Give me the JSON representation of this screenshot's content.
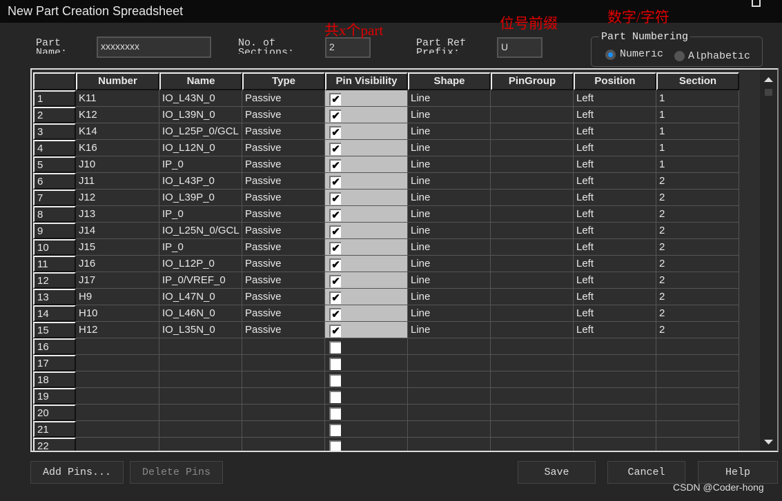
{
  "window": {
    "title": "New Part Creation Spreadsheet"
  },
  "form": {
    "part_name_label": "Part\nName:",
    "part_name_value": "xxxxxxxx",
    "sections_label": "No. of\nSections:",
    "sections_value": "2",
    "ref_prefix_label": "Part Ref\nPrefix:",
    "ref_prefix_value": "U",
    "numbering": {
      "title": "Part Numbering",
      "numeric": "Numeric",
      "alphabetic": "Alphabetic",
      "selected": "Numeric"
    }
  },
  "annotations": {
    "sections": "共x个part",
    "prefix": "位号前缀",
    "numbering": "数字/字符"
  },
  "table": {
    "columns": [
      "Number",
      "Name",
      "Type",
      "Pin Visibility",
      "Shape",
      "PinGroup",
      "Position",
      "Section"
    ],
    "rows": [
      {
        "n": "1",
        "number": "K11",
        "name": "IO_L43N_0",
        "type": "Passive",
        "visible": true,
        "shape": "Line",
        "group": "",
        "position": "Left",
        "section": "1"
      },
      {
        "n": "2",
        "number": "K12",
        "name": "IO_L39N_0",
        "type": "Passive",
        "visible": true,
        "shape": "Line",
        "group": "",
        "position": "Left",
        "section": "1"
      },
      {
        "n": "3",
        "number": "K14",
        "name": "IO_L25P_0/GCL",
        "type": "Passive",
        "visible": true,
        "shape": "Line",
        "group": "",
        "position": "Left",
        "section": "1"
      },
      {
        "n": "4",
        "number": "K16",
        "name": "IO_L12N_0",
        "type": "Passive",
        "visible": true,
        "shape": "Line",
        "group": "",
        "position": "Left",
        "section": "1"
      },
      {
        "n": "5",
        "number": "J10",
        "name": "IP_0",
        "type": "Passive",
        "visible": true,
        "shape": "Line",
        "group": "",
        "position": "Left",
        "section": "1"
      },
      {
        "n": "6",
        "number": "J11",
        "name": "IO_L43P_0",
        "type": "Passive",
        "visible": true,
        "shape": "Line",
        "group": "",
        "position": "Left",
        "section": "2"
      },
      {
        "n": "7",
        "number": "J12",
        "name": "IO_L39P_0",
        "type": "Passive",
        "visible": true,
        "shape": "Line",
        "group": "",
        "position": "Left",
        "section": "2"
      },
      {
        "n": "8",
        "number": "J13",
        "name": "IP_0",
        "type": "Passive",
        "visible": true,
        "shape": "Line",
        "group": "",
        "position": "Left",
        "section": "2"
      },
      {
        "n": "9",
        "number": "J14",
        "name": "IO_L25N_0/GCL",
        "type": "Passive",
        "visible": true,
        "shape": "Line",
        "group": "",
        "position": "Left",
        "section": "2"
      },
      {
        "n": "10",
        "number": "J15",
        "name": "IP_0",
        "type": "Passive",
        "visible": true,
        "shape": "Line",
        "group": "",
        "position": "Left",
        "section": "2"
      },
      {
        "n": "11",
        "number": "J16",
        "name": "IO_L12P_0",
        "type": "Passive",
        "visible": true,
        "shape": "Line",
        "group": "",
        "position": "Left",
        "section": "2"
      },
      {
        "n": "12",
        "number": "J17",
        "name": "IP_0/VREF_0",
        "type": "Passive",
        "visible": true,
        "shape": "Line",
        "group": "",
        "position": "Left",
        "section": "2"
      },
      {
        "n": "13",
        "number": "H9",
        "name": "IO_L47N_0",
        "type": "Passive",
        "visible": true,
        "shape": "Line",
        "group": "",
        "position": "Left",
        "section": "2"
      },
      {
        "n": "14",
        "number": "H10",
        "name": "IO_L46N_0",
        "type": "Passive",
        "visible": true,
        "shape": "Line",
        "group": "",
        "position": "Left",
        "section": "2"
      },
      {
        "n": "15",
        "number": "H12",
        "name": "IO_L35N_0",
        "type": "Passive",
        "visible": true,
        "shape": "Line",
        "group": "",
        "position": "Left",
        "section": "2"
      },
      {
        "n": "16",
        "empty": true
      },
      {
        "n": "17",
        "empty": true
      },
      {
        "n": "18",
        "empty": true
      },
      {
        "n": "19",
        "empty": true
      },
      {
        "n": "20",
        "empty": true
      },
      {
        "n": "21",
        "empty": true
      },
      {
        "n": "22",
        "empty": true
      }
    ]
  },
  "buttons": {
    "add": "Add Pins...",
    "delete": "Delete Pins",
    "save": "Save",
    "cancel": "Cancel",
    "help": "Help"
  },
  "watermark": "CSDN @Coder-hong",
  "colors": {
    "accent": "#1a8fff",
    "annotation": "#e00000"
  }
}
